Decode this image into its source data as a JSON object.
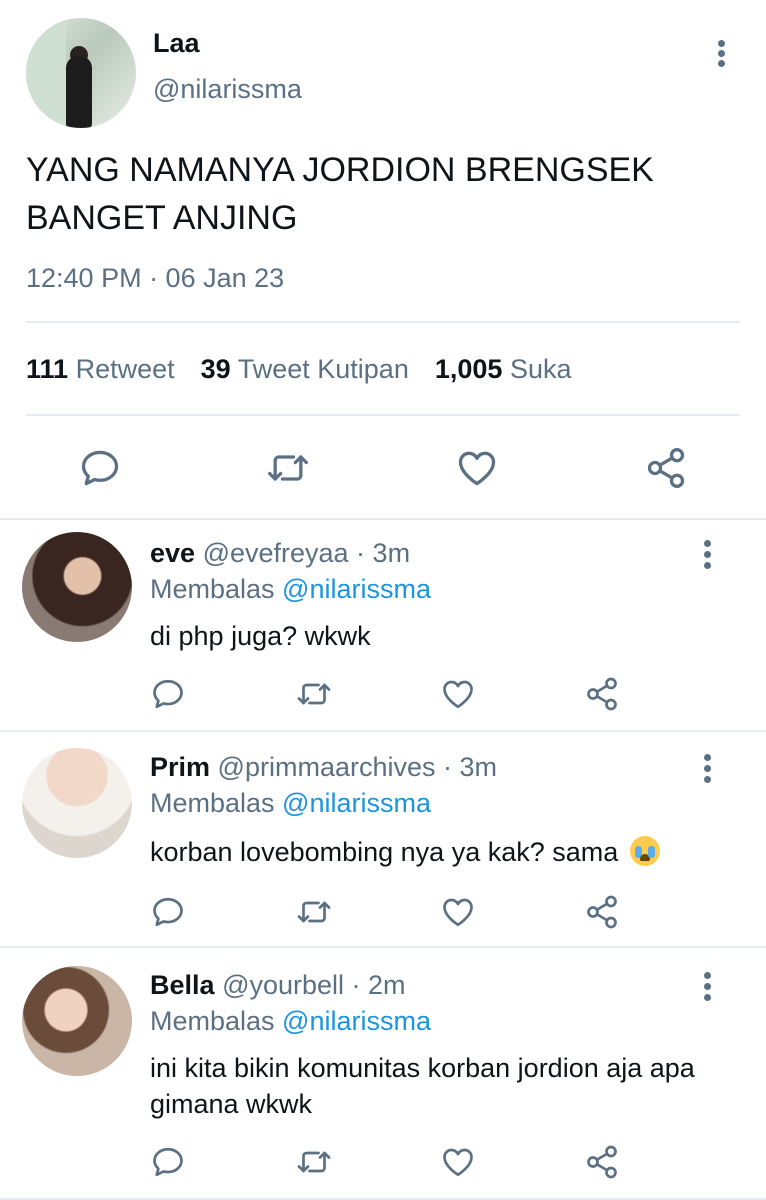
{
  "tweet": {
    "name": "Laa",
    "handle": "@nilarissma",
    "text": "YANG NAMANYA JORDION BRENGSEK BANGET ANJING",
    "time": "12:40 PM · 06 Jan 23",
    "stats": {
      "retweets": "111",
      "retweets_label": "Retweet",
      "quotes": "39",
      "quotes_label": "Tweet Kutipan",
      "likes": "1,005",
      "likes_label": "Suka"
    },
    "actions": [
      "reply-icon",
      "retweet-icon",
      "like-icon",
      "share-icon"
    ]
  },
  "replies": [
    {
      "name": "eve",
      "handle": "@evefreyaa · 3m",
      "replying_prefix": "Membalas ",
      "replying_to": "@nilarissma",
      "text": "di php juga? wkwk"
    },
    {
      "name": "Prim",
      "handle": "@primmaarchives · 3m",
      "replying_prefix": "Membalas ",
      "replying_to": "@nilarissma",
      "text": "korban lovebombing nya ya kak? sama",
      "emoji": "loudly-crying-face-emoji"
    },
    {
      "name": "Bella",
      "handle": "@yourbell · 2m",
      "replying_prefix": "Membalas ",
      "replying_to": "@nilarissma",
      "text": "ini kita bikin komunitas korban jordion aja apa gimana wkwk"
    }
  ],
  "colors": {
    "primary_text": "#0f1419",
    "secondary_text": "#5b7083",
    "mention": "#1b95e0",
    "divider": "#e6ecf0",
    "icon": "#5b7083"
  }
}
